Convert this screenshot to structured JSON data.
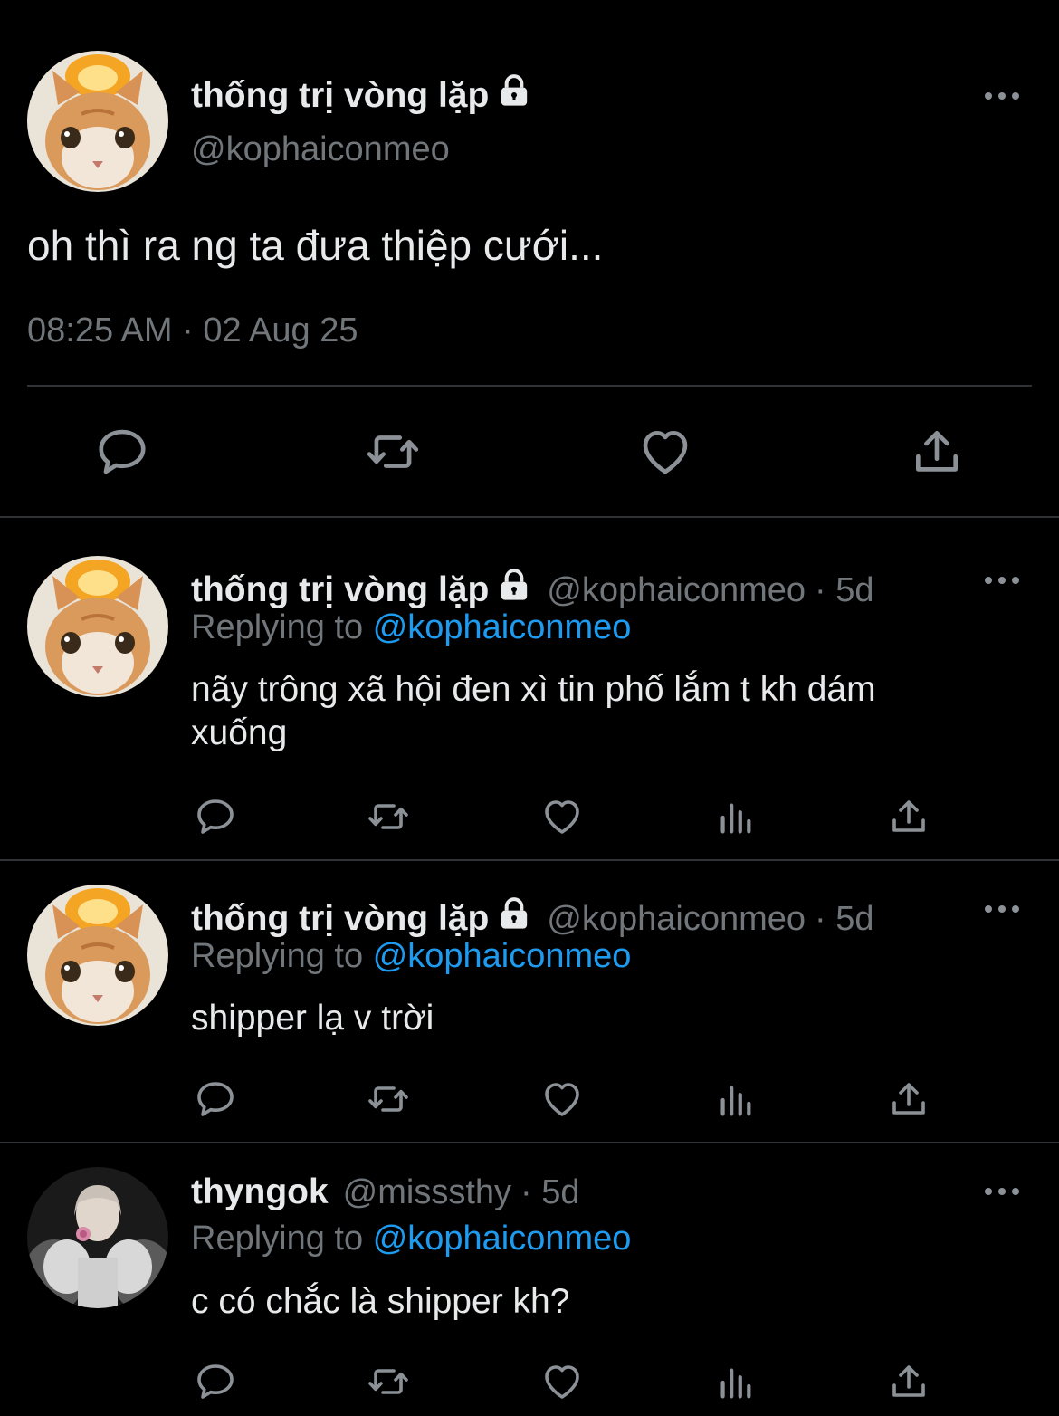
{
  "main_tweet": {
    "display_name": "thống trị vòng lặp",
    "handle": "@kophaiconmeo",
    "text": "oh thì ra ng ta đưa thiệp cưới...",
    "timestamp": "08:25 AM · 02 Aug 25",
    "icons": [
      "lock-icon",
      "more-icon",
      "reply-icon",
      "retweet-icon",
      "like-icon",
      "share-icon"
    ]
  },
  "replies": [
    {
      "display_name": "thống trị vòng lặp",
      "handle": "@kophaiconmeo",
      "time": "· 5d",
      "replying_prefix": "Replying to",
      "replying_to": "@kophaiconmeo",
      "text_line1": "nãy trông xã hội đen xì tin phố lắm t kh dám",
      "text_line2": "xuống"
    },
    {
      "display_name": "thống trị vòng lặp",
      "handle": "@kophaiconmeo",
      "time": "· 5d",
      "replying_prefix": "Replying to",
      "replying_to": "@kophaiconmeo",
      "text_line1": "shipper lạ v trời"
    },
    {
      "display_name": "thyngok",
      "handle": "@misssthy",
      "time": "· 5d",
      "replying_prefix": "Replying to",
      "replying_to": "@kophaiconmeo",
      "text_line1": "c có chắc là shipper kh?"
    }
  ],
  "colors": {
    "background": "#000000",
    "text": "#e7e9ea",
    "muted": "#71767b",
    "link": "#1d9bf0",
    "divider": "#2f3336"
  }
}
